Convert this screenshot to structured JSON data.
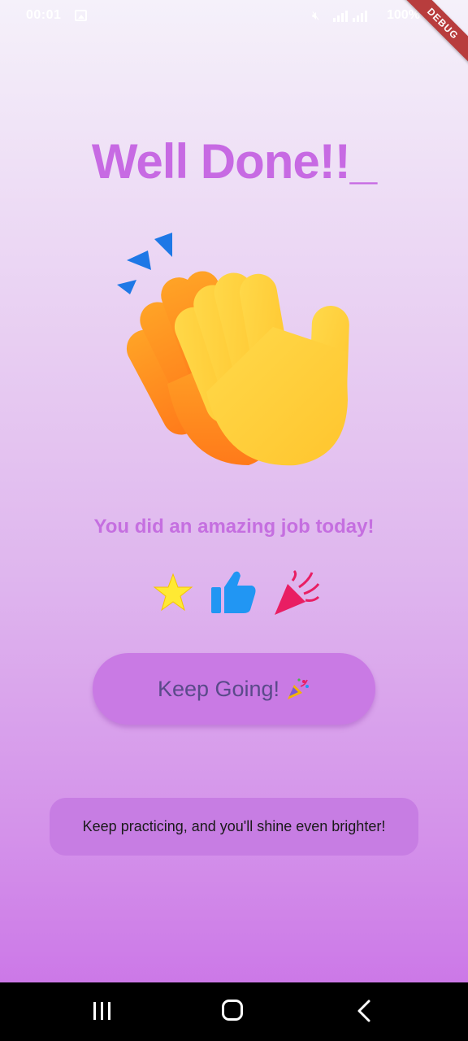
{
  "status_bar": {
    "time": "00:01",
    "battery": "100%",
    "debug_banner": "DEBUG"
  },
  "main": {
    "title": "Well Done!!_",
    "illustration": "clapping-hands",
    "subtitle": "You did an amazing job today!",
    "icons": [
      "star-icon",
      "thumbs-up-icon",
      "party-popper-icon"
    ],
    "button": {
      "label": "Keep Going!",
      "emoji": "party-popper"
    },
    "message": "Keep practicing, and you'll shine even brighter!"
  },
  "nav_bar": {
    "items": [
      "recents",
      "home",
      "back"
    ]
  },
  "colors": {
    "title": "#c76ae3",
    "subtitle": "#c56fe0",
    "button_bg": "#c97ae4",
    "button_text": "#5a4a8a",
    "card_bg": "#c77de3",
    "gradient_bottom": "#c96ee6"
  }
}
